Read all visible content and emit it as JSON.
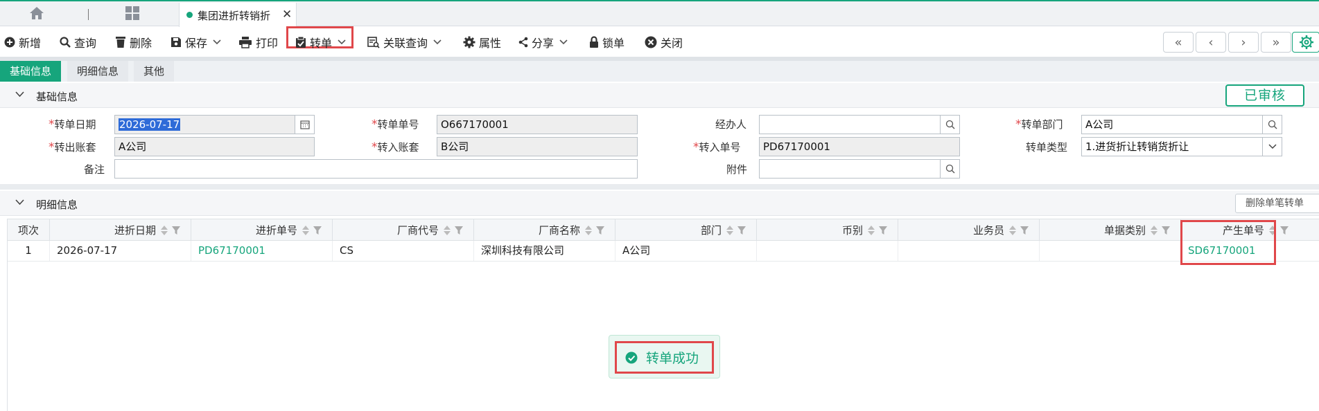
{
  "tabbar": {
    "home_icon": "home-icon",
    "grid_icon": "grid-icon",
    "doc_tab_label": "集团进折转销折",
    "close_glyph": "✕"
  },
  "toolbar": {
    "new": "新增",
    "query": "查询",
    "delete": "删除",
    "save": "保存",
    "print": "打印",
    "transfer": "转单",
    "related_query": "关联查询",
    "properties": "属性",
    "share": "分享",
    "lock": "锁单",
    "close": "关闭",
    "nav": [
      "«",
      "‹",
      "›",
      "»"
    ]
  },
  "section_tabs": [
    "基础信息",
    "明细信息",
    "其他"
  ],
  "basic_section": {
    "title": "基础信息",
    "status": "已审核"
  },
  "form": {
    "transfer_date": {
      "label": "转单日期",
      "value": "2026-07-17"
    },
    "transfer_no": {
      "label": "转单单号",
      "value": "O667170001"
    },
    "handler": {
      "label": "经办人",
      "value": ""
    },
    "transfer_dept": {
      "label": "转单部门",
      "value": "A公司"
    },
    "out_account": {
      "label": "转出账套",
      "value": "A公司"
    },
    "in_account": {
      "label": "转入账套",
      "value": "B公司"
    },
    "in_no": {
      "label": "转入单号",
      "value": "PD67170001"
    },
    "transfer_type": {
      "label": "转单类型",
      "value": "1.进货折让转销货折让"
    },
    "remark": {
      "label": "备注",
      "value": ""
    },
    "attachment": {
      "label": "附件",
      "value": ""
    }
  },
  "detail_section": {
    "title": "明细信息",
    "delete_single": "删除单笔转单"
  },
  "grid": {
    "columns": [
      "项次",
      "进折日期",
      "进折单号",
      "厂商代号",
      "厂商名称",
      "部门",
      "币别",
      "业务员",
      "单据类别",
      "产生单号"
    ],
    "rows": [
      [
        "1",
        "2026-07-17",
        "PD67170001",
        "CS",
        "深圳科技有限公司",
        "A公司",
        "",
        "",
        "",
        "SD67170001"
      ]
    ]
  },
  "toast": {
    "message": "转单成功"
  },
  "colors": {
    "accent": "#16a57c",
    "highlight": "#e0474a"
  }
}
